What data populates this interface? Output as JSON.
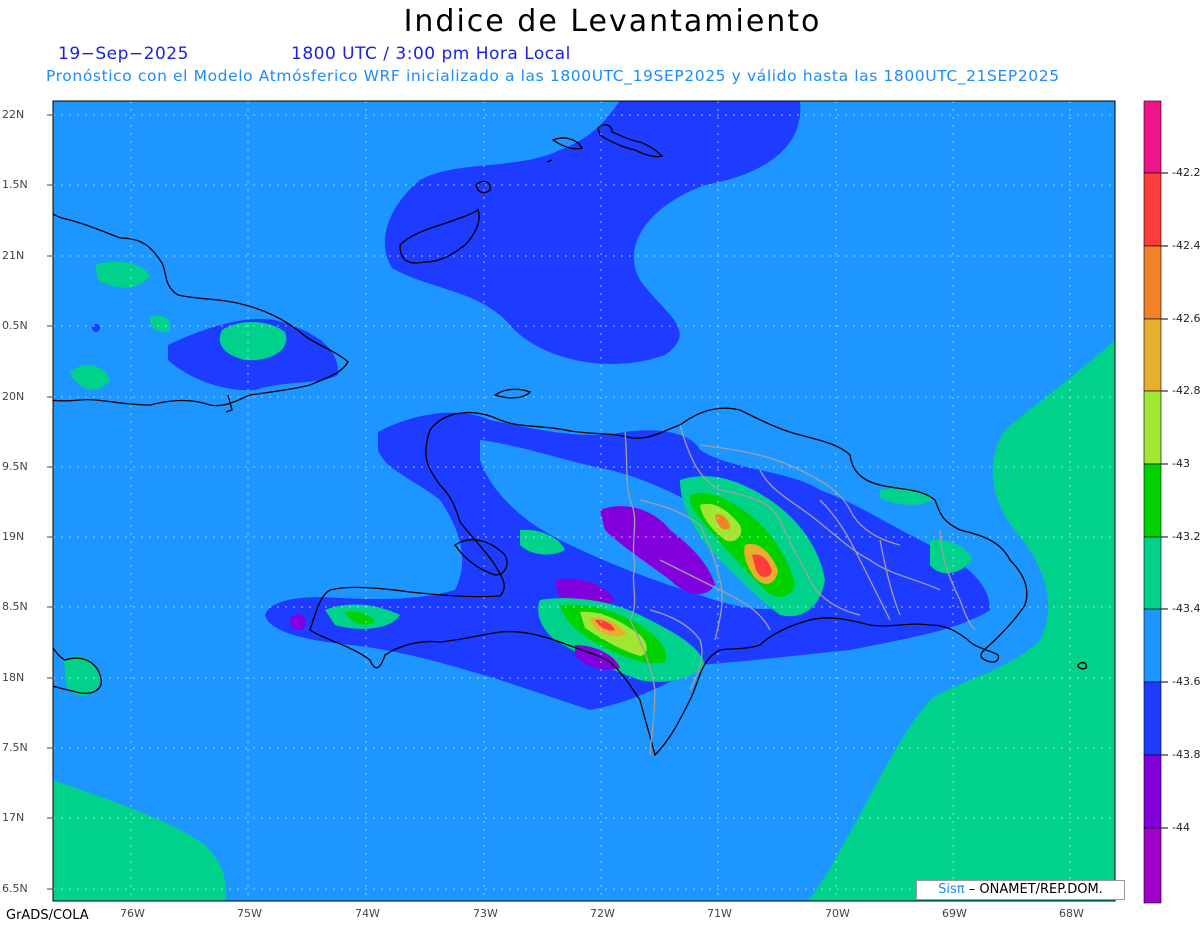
{
  "title": "Indice de Levantamiento",
  "subtitle_date": "19−Sep−2025",
  "subtitle_time": "1800 UTC / 3:00 pm Hora Local",
  "subtitle_model": "Pronóstico con el Modelo Atmósferico WRF inicializado a las 1800UTC_19SEP2025 y válido hasta las  1800UTC_21SEP2025",
  "credit": {
    "brand": "Sisπ",
    "text": "– ONAMET/REP.DOM."
  },
  "software": "GrADS/COLA",
  "lat_labels": [
    "22N",
    "1.5N",
    "21N",
    "0.5N",
    "20N",
    "9.5N",
    "19N",
    "8.5N",
    "18N",
    "7.5N",
    "17N",
    "6.5N"
  ],
  "lon_labels": [
    "76W",
    "75W",
    "74W",
    "73W",
    "72W",
    "71W",
    "70W",
    "69W",
    "68W"
  ],
  "colorbar": {
    "labels": [
      "-42.2",
      "-42.4",
      "-42.6",
      "-42.8",
      "-43",
      "-43.2",
      "-43.4",
      "-43.6",
      "-43.8",
      "-44"
    ],
    "colors": [
      "#f0148c",
      "#ff3c3c",
      "#f08228",
      "#e6af2d",
      "#a0e632",
      "#00d200",
      "#00d28c",
      "#1e96ff",
      "#1e3cff",
      "#8200dc",
      "#a000c8"
    ]
  },
  "map_colors": {
    "background": "#1e96ff",
    "low": "#1e3cff",
    "high": "#00d28c",
    "coast": "#000000",
    "borders": "#a0a0a0"
  }
}
